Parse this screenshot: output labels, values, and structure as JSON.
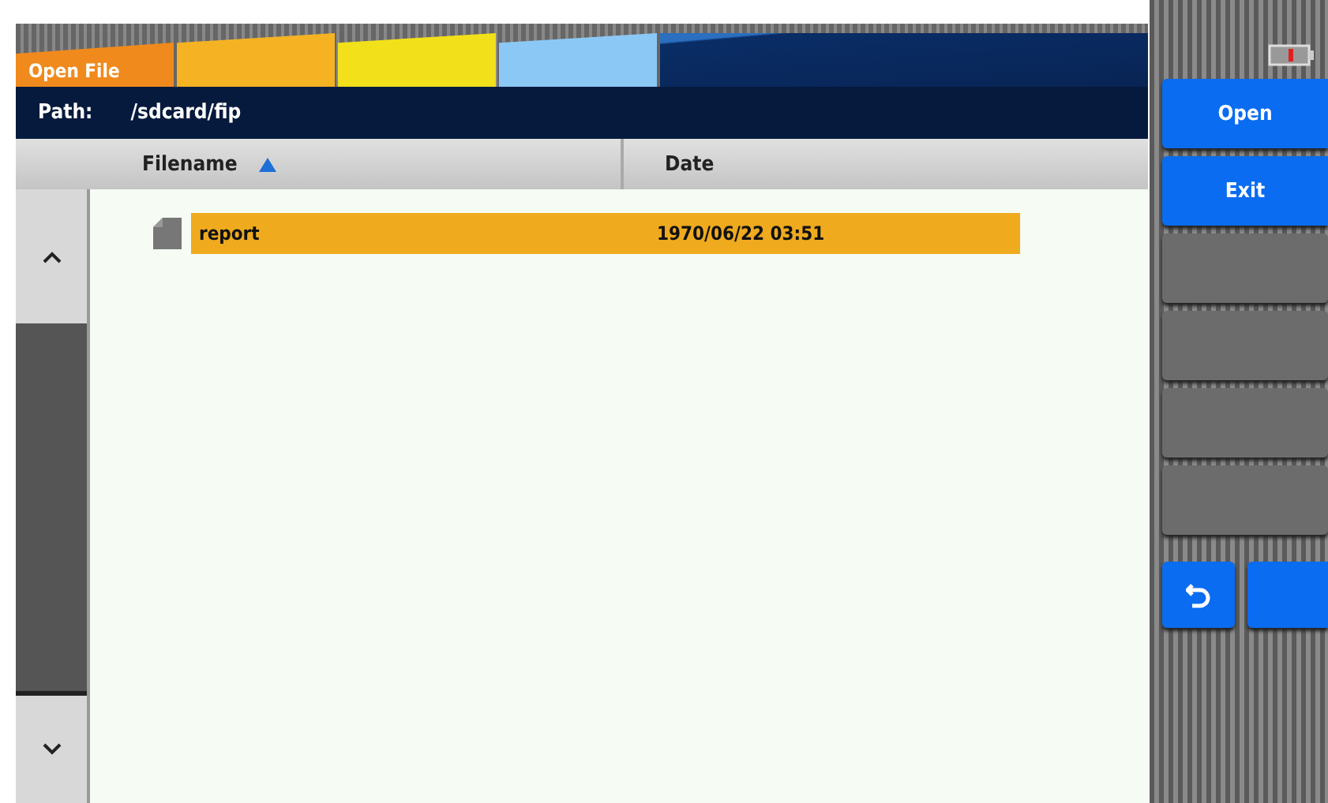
{
  "tabs": [
    {
      "label": "Open File",
      "selected": true,
      "color": "#f08a1c"
    },
    {
      "selected": false,
      "color": "#f5b323"
    },
    {
      "selected": false,
      "color": "#f2e01a"
    },
    {
      "selected": false,
      "color": "#8cc8f5"
    }
  ],
  "path": {
    "label": "Path:",
    "value": "/sdcard/fip"
  },
  "table": {
    "columns": [
      {
        "label": "Filename",
        "sorted": true
      },
      {
        "label": "Date",
        "sorted": false
      }
    ],
    "rows": [
      {
        "filename": "report",
        "date": "1970/06/22 03:51",
        "selected": true
      }
    ]
  },
  "side_buttons": [
    {
      "kind": "text",
      "label": "Open"
    },
    {
      "kind": "text",
      "label": "Exit"
    },
    {
      "kind": "blank"
    },
    {
      "kind": "blank"
    },
    {
      "kind": "blank"
    },
    {
      "kind": "blank"
    }
  ],
  "bottom_buttons": [
    {
      "kind": "back"
    },
    {
      "kind": "empty"
    }
  ]
}
